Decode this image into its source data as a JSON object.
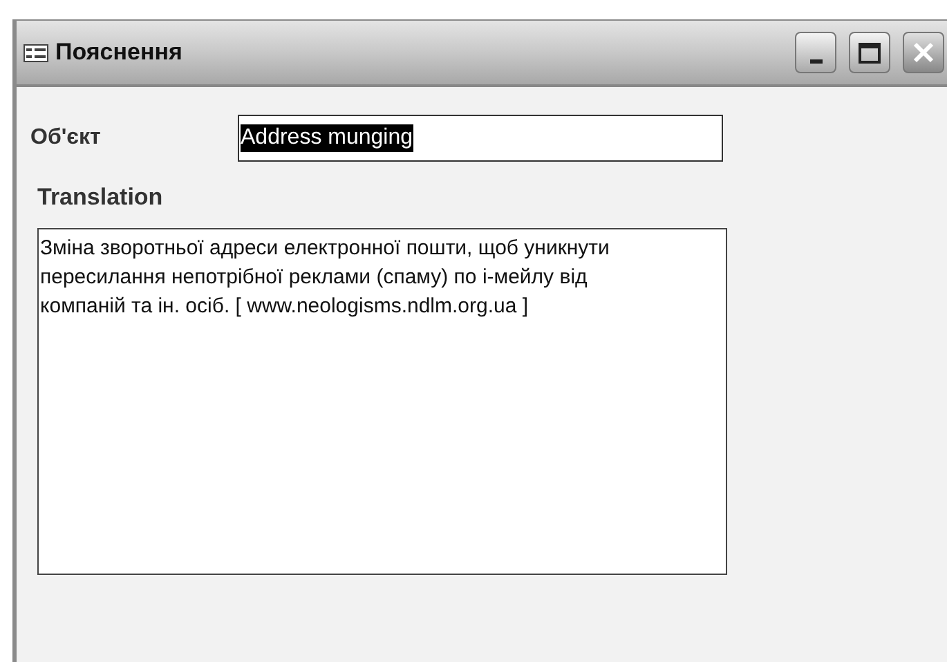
{
  "window": {
    "title": "Пояснення"
  },
  "object_field": {
    "label": "Об'єкт",
    "value": "Address munging",
    "selected": true
  },
  "translation": {
    "label": "Translation",
    "value": "Зміна зворотньої адреси електронної пошти, щоб уникнути пересилання непотрібної реклами (спаму) по і-мейлу від компаній та ін. осіб. [ www.neologisms.ndlm.org.ua ]"
  }
}
